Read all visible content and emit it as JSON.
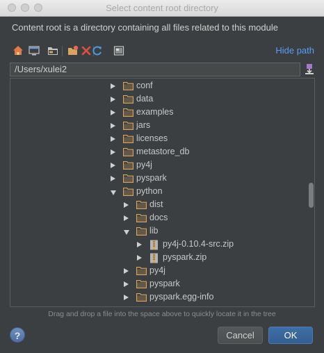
{
  "window": {
    "title": "Select content root directory"
  },
  "description": "Content root is a directory containing all files related to this module",
  "toolbar": {
    "icons": [
      "home-icon",
      "desktop-icon",
      "project-folder-icon",
      "new-folder-icon",
      "delete-icon",
      "refresh-icon",
      "show-hidden-icon"
    ],
    "hide_path_label": "Hide path"
  },
  "path": {
    "value": "/Users/xulei2"
  },
  "tree": {
    "items": [
      {
        "label": "conf",
        "kind": "folder",
        "expanded": false,
        "depth": 0
      },
      {
        "label": "data",
        "kind": "folder",
        "expanded": false,
        "depth": 0
      },
      {
        "label": "examples",
        "kind": "folder",
        "expanded": false,
        "depth": 0
      },
      {
        "label": "jars",
        "kind": "folder",
        "expanded": false,
        "depth": 0
      },
      {
        "label": "licenses",
        "kind": "folder",
        "expanded": false,
        "depth": 0
      },
      {
        "label": "metastore_db",
        "kind": "folder",
        "expanded": false,
        "depth": 0
      },
      {
        "label": "py4j",
        "kind": "folder",
        "expanded": false,
        "depth": 0
      },
      {
        "label": "pyspark",
        "kind": "folder",
        "expanded": false,
        "depth": 0
      },
      {
        "label": "python",
        "kind": "folder",
        "expanded": true,
        "depth": 0
      },
      {
        "label": "dist",
        "kind": "folder",
        "expanded": false,
        "depth": 1
      },
      {
        "label": "docs",
        "kind": "folder",
        "expanded": false,
        "depth": 1
      },
      {
        "label": "lib",
        "kind": "folder",
        "expanded": true,
        "depth": 1
      },
      {
        "label": "py4j-0.10.4-src.zip",
        "kind": "zip",
        "expanded": false,
        "depth": 2
      },
      {
        "label": "pyspark.zip",
        "kind": "zip",
        "expanded": false,
        "depth": 2
      },
      {
        "label": "py4j",
        "kind": "folder",
        "expanded": false,
        "depth": 1
      },
      {
        "label": "pyspark",
        "kind": "folder",
        "expanded": false,
        "depth": 1
      },
      {
        "label": "pyspark.egg-info",
        "kind": "folder",
        "expanded": false,
        "depth": 1
      }
    ]
  },
  "hint": "Drag and drop a file into the space above to quickly locate it in the tree",
  "buttons": {
    "help": "?",
    "cancel": "Cancel",
    "ok": "OK"
  },
  "colors": {
    "background": "#3c3f41",
    "link": "#589df6",
    "ok_button": "#365f92",
    "folder": "#d9a55b"
  }
}
